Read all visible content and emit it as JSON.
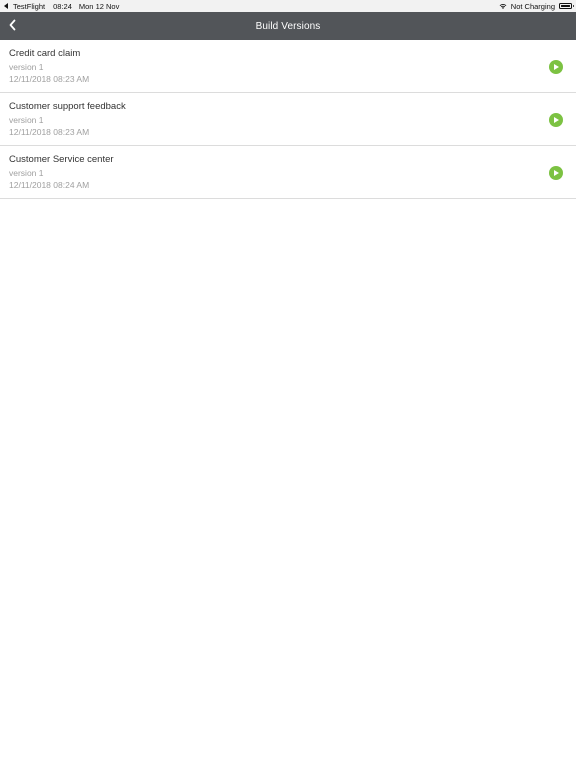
{
  "status_bar": {
    "app_back": "TestFlight",
    "time": "08:24",
    "date": "Mon 12 Nov",
    "charging": "Not Charging"
  },
  "nav": {
    "title": "Build Versions"
  },
  "builds": [
    {
      "title": "Credit card claim",
      "version": "version 1",
      "date": "12/11/2018 08:23 AM"
    },
    {
      "title": "Customer support feedback",
      "version": "version 1",
      "date": "12/11/2018 08:23 AM"
    },
    {
      "title": "Customer Service center",
      "version": "version 1",
      "date": "12/11/2018 08:24 AM"
    }
  ],
  "colors": {
    "nav_background": "#525559",
    "play_accent": "#7cc242"
  },
  "icons": {
    "back": "chevron-left-icon",
    "play": "play-icon",
    "wifi": "wifi-icon",
    "battery": "battery-icon"
  }
}
